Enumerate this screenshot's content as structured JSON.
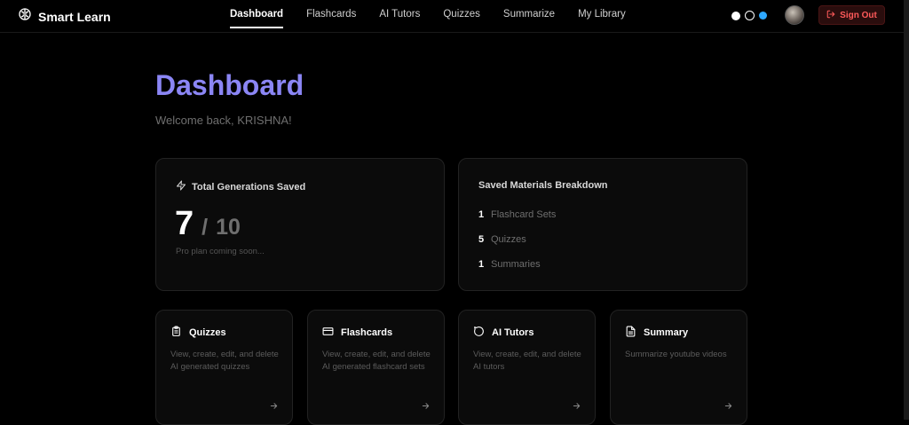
{
  "header": {
    "brand": "Smart Learn",
    "nav": [
      {
        "label": "Dashboard",
        "active": true
      },
      {
        "label": "Flashcards",
        "active": false
      },
      {
        "label": "AI Tutors",
        "active": false
      },
      {
        "label": "Quizzes",
        "active": false
      },
      {
        "label": "Summarize",
        "active": false
      },
      {
        "label": "My Library",
        "active": false
      }
    ],
    "theme_options": [
      "white",
      "outline",
      "blue"
    ],
    "sign_out_label": "Sign Out"
  },
  "main": {
    "title": "Dashboard",
    "welcome": "Welcome back, KRISHNA!",
    "generations": {
      "title": "Total Generations Saved",
      "value": "7",
      "separator": "/",
      "max": "10",
      "note": "Pro plan coming soon..."
    },
    "materials": {
      "title": "Saved Materials Breakdown",
      "rows": [
        {
          "count": "1",
          "label": "Flashcard Sets"
        },
        {
          "count": "5",
          "label": "Quizzes"
        },
        {
          "count": "1",
          "label": "Summaries"
        }
      ]
    },
    "features": [
      {
        "title": "Quizzes",
        "icon": "clipboard-icon",
        "description": "View, create, edit, and delete AI generated quizzes"
      },
      {
        "title": "Flashcards",
        "icon": "credit-card-icon",
        "description": "View, create, edit, and delete AI generated flashcard sets"
      },
      {
        "title": "AI Tutors",
        "icon": "chat-bubble-icon",
        "description": "View, create, edit, and delete AI tutors"
      },
      {
        "title": "Summary",
        "icon": "document-icon",
        "description": "Summarize youtube videos"
      }
    ]
  },
  "colors": {
    "accent": "#8b86f5",
    "sign_out": "#ff5a5a",
    "theme_blue": "#2ea8ff"
  }
}
